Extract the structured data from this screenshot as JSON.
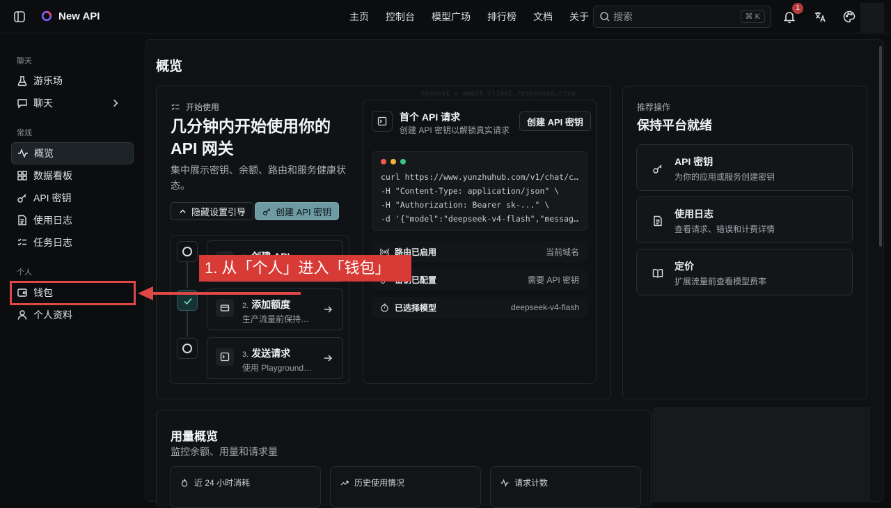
{
  "app": {
    "brand": "New API"
  },
  "nav": [
    "主页",
    "控制台",
    "模型广场",
    "排行榜",
    "文档",
    "关于"
  ],
  "search": {
    "placeholder": "搜索",
    "shortcut": "⌘ K"
  },
  "notifications": {
    "count": "1"
  },
  "sidebar": {
    "groups": [
      {
        "label": "聊天",
        "items": [
          {
            "label": "游乐场",
            "icon": "flask-icon"
          },
          {
            "label": "聊天",
            "icon": "chat-icon"
          }
        ]
      },
      {
        "label": "常规",
        "items": [
          {
            "label": "概览",
            "icon": "activity-icon"
          },
          {
            "label": "数据看板",
            "icon": "grid-icon"
          },
          {
            "label": "API 密钥",
            "icon": "key-icon"
          },
          {
            "label": "使用日志",
            "icon": "file-icon"
          },
          {
            "label": "任务日志",
            "icon": "checklist-icon"
          }
        ]
      },
      {
        "label": "个人",
        "items": [
          {
            "label": "钱包",
            "icon": "wallet-icon"
          },
          {
            "label": "个人资料",
            "icon": "user-icon"
          }
        ]
      }
    ],
    "active": "概览"
  },
  "page": {
    "title": "概览"
  },
  "get_started": {
    "eyebrow": "开始使用",
    "headline": "几分钟内开始使用你的 API 网关",
    "description": "集中展示密钥、余额、路由和服务健康状态。",
    "hide_button": "隐藏设置引导",
    "create_button": "创建 API 密钥",
    "steps": [
      {
        "num": "1.",
        "title": "创建 API",
        "sub": ""
      },
      {
        "num": "2.",
        "title": "添加额度",
        "sub": "生产流量前保持…"
      },
      {
        "num": "3.",
        "title": "发送请求",
        "sub": "使用 Playground…"
      }
    ],
    "decorative_code": "request = await client.responses.crea"
  },
  "first_request": {
    "title": "首个 API 请求",
    "subtitle": "创建 API 密钥以解锁真实请求",
    "button": "创建 API 密钥",
    "code": [
      "curl https://www.yunzhuhub.com/v1/chat/com…",
      "-H \"Content-Type: application/json\" \\",
      "-H \"Authorization: Bearer sk-...\" \\",
      "-d '{\"model\":\"deepseek-v4-flash\",\"messages…"
    ],
    "status": [
      {
        "label": "路由已启用",
        "value": "当前域名",
        "icon": "broadcast-icon"
      },
      {
        "label": "密钥已配置",
        "value": "需要 API 密钥",
        "icon": "key-icon"
      },
      {
        "label": "已选择模型",
        "value": "deepseek-v4-flash",
        "icon": "timer-icon"
      }
    ]
  },
  "recommended": {
    "eyebrow": "推荐操作",
    "title": "保持平台就绪",
    "items": [
      {
        "title": "API 密钥",
        "sub": "为你的应用或服务创建密钥",
        "icon": "key-icon"
      },
      {
        "title": "使用日志",
        "sub": "查看请求、错误和计费详情",
        "icon": "file-icon"
      },
      {
        "title": "定价",
        "sub": "扩展流量前查看模型费率",
        "icon": "book-icon"
      }
    ]
  },
  "usage": {
    "title": "用量概览",
    "subtitle": "监控余额、用量和请求量",
    "cards": [
      {
        "label": "近 24 小时消耗",
        "icon": "flame-icon"
      },
      {
        "label": "历史使用情况",
        "icon": "trend-icon"
      },
      {
        "label": "请求计数",
        "icon": "activity-icon"
      }
    ]
  },
  "annotation": {
    "callout": "1. 从「个人」进入「钱包」"
  },
  "colors": {
    "accent": "#6d9aa3",
    "annotation_red": "#d83a36"
  }
}
